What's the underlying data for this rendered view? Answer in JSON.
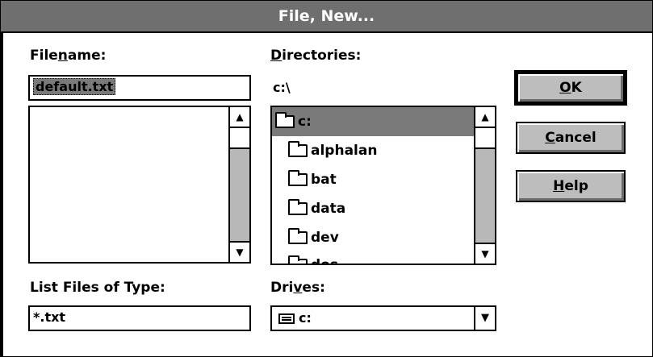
{
  "window": {
    "title": "File, New..."
  },
  "filename": {
    "label_pre": "File",
    "label_key": "n",
    "label_post": "ame:",
    "value": "default.txt"
  },
  "directories": {
    "label_key": "D",
    "label_post": "irectories:",
    "current_path": "c:\\",
    "items": [
      {
        "label": "c:",
        "icon": "open-folder-icon",
        "selected": true
      },
      {
        "label": "alphalan",
        "icon": "folder-icon"
      },
      {
        "label": "bat",
        "icon": "folder-icon"
      },
      {
        "label": "data",
        "icon": "folder-icon"
      },
      {
        "label": "dev",
        "icon": "folder-icon"
      },
      {
        "label": "dos",
        "icon": "folder-icon"
      }
    ]
  },
  "file_type": {
    "label": "List Files of Type:",
    "value": "*.txt"
  },
  "drives": {
    "label_pre": "Dri",
    "label_key": "v",
    "label_post": "es:",
    "value": "c:"
  },
  "buttons": {
    "ok_key": "O",
    "ok_rest": "K",
    "cancel_key": "C",
    "cancel_rest": "ancel",
    "help_key": "H",
    "help_rest": "elp"
  },
  "icons": {
    "scroll_up": "up-arrow-icon",
    "scroll_down": "down-arrow-icon",
    "dropdown": "dropdown-arrow-icon",
    "drive": "drive-icon"
  },
  "colors": {
    "titlebar": "#6f6f6f",
    "button_face": "#bdbdbd",
    "selection": "#7a7a7a",
    "scroll_track": "#b8b8b8"
  }
}
